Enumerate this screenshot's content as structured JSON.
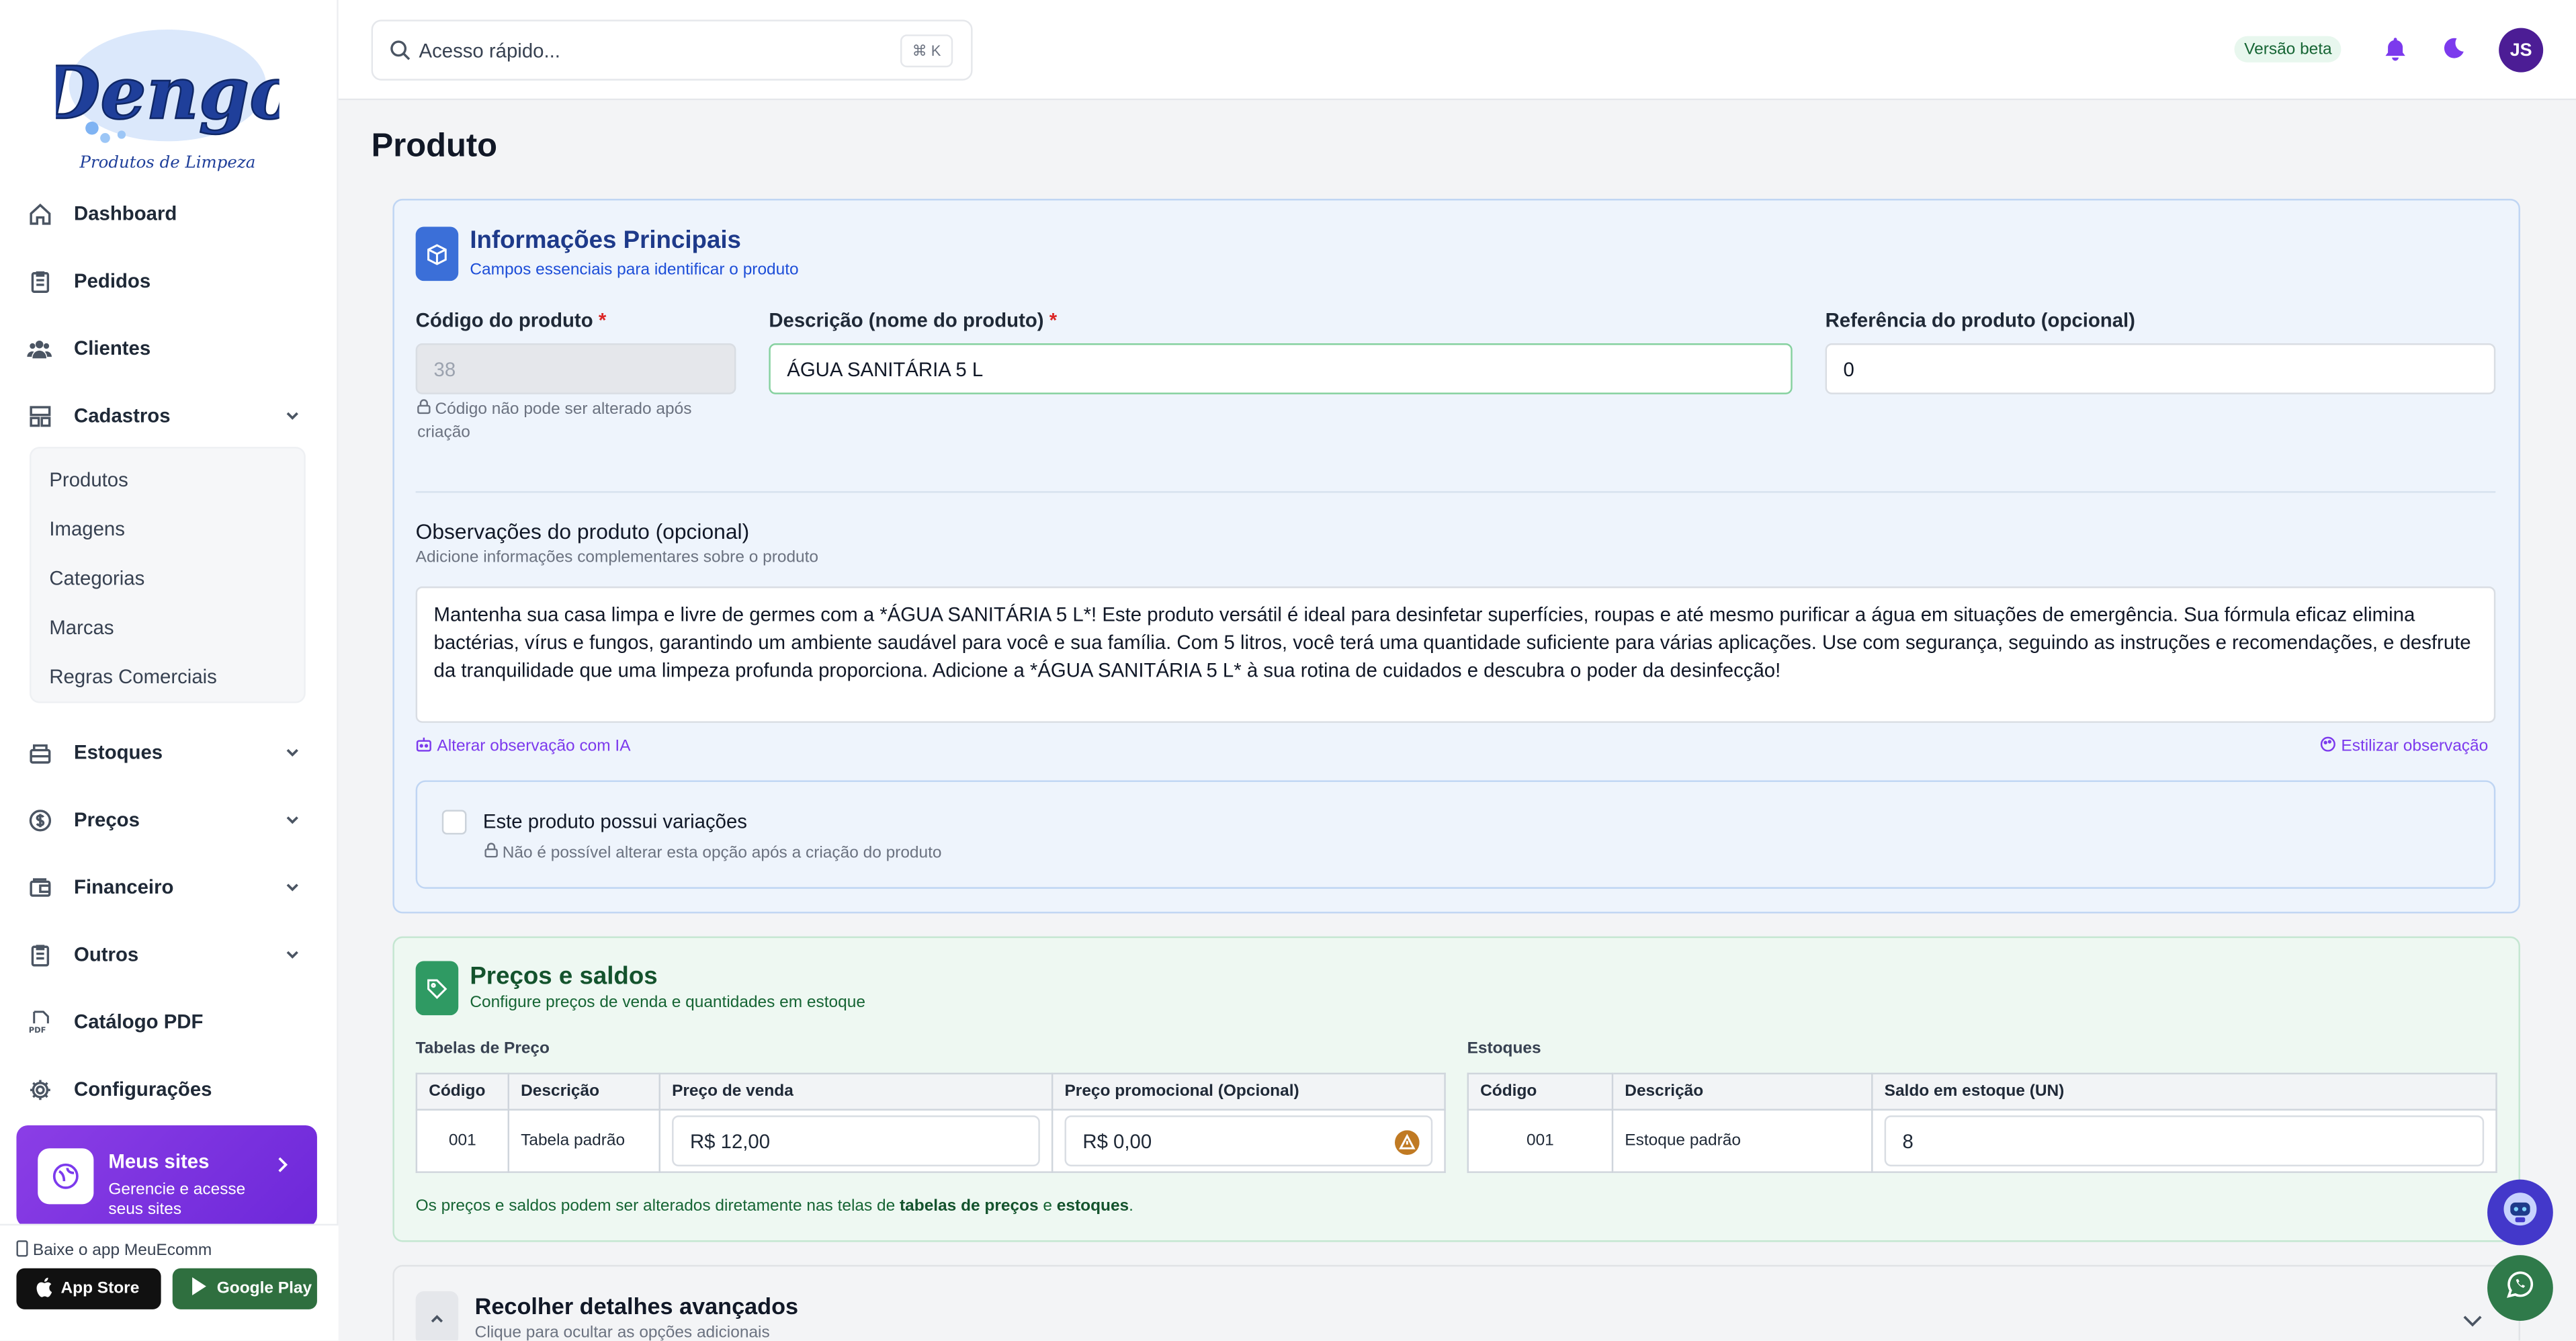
{
  "brand": {
    "logo_text": "Dengo",
    "logo_tagline": "Produtos de Limpeza"
  },
  "sidebar": {
    "items": [
      {
        "label": "Dashboard",
        "icon": "home-icon"
      },
      {
        "label": "Pedidos",
        "icon": "clipboard-icon"
      },
      {
        "label": "Clientes",
        "icon": "users-icon"
      },
      {
        "label": "Cadastros",
        "icon": "grid-icon",
        "expanded": true
      },
      {
        "label": "Estoques",
        "icon": "box-icon"
      },
      {
        "label": "Preços",
        "icon": "dollar-icon"
      },
      {
        "label": "Financeiro",
        "icon": "wallet-icon"
      },
      {
        "label": "Outros",
        "icon": "clipboard-icon"
      },
      {
        "label": "Catálogo PDF",
        "icon": "pdf-icon"
      },
      {
        "label": "Configurações",
        "icon": "gear-icon"
      }
    ],
    "subitems": [
      "Produtos",
      "Imagens",
      "Categorias",
      "Marcas",
      "Regras Comerciais"
    ],
    "promo": {
      "title": "Meus sites",
      "subtitle": "Gerencie e acesse seus sites"
    },
    "app": {
      "label": "Baixe o app MeuEcomm",
      "app_store": "App Store",
      "google_play": "Google Play"
    }
  },
  "topbar": {
    "search_placeholder": "Acesso rápido...",
    "shortcut": "⌘ K",
    "beta": "Versão beta",
    "avatar": "JS"
  },
  "page": {
    "title": "Produto"
  },
  "info": {
    "title": "Informações Principais",
    "subtitle": "Campos essenciais para identificar o produto",
    "code_label": "Código do produto",
    "code_value": "38",
    "code_hint": "Código não pode ser alterado após criação",
    "desc_label": "Descrição (nome do produto)",
    "desc_value": "ÁGUA SANITÁRIA 5 L",
    "ref_label": "Referência do produto (opcional)",
    "ref_value": "0",
    "obs_label": "Observações do produto (opcional)",
    "obs_sub": "Adicione informações complementares sobre o produto",
    "obs_value": "Mantenha sua casa limpa e livre de germes com a *ÁGUA SANITÁRIA 5 L*! Este produto versátil é ideal para desinfetar superfícies, roupas e até mesmo purificar a água em situações de emergência. Sua fórmula eficaz elimina bactérias, vírus e fungos, garantindo um ambiente saudável para você e sua família. Com 5 litros, você terá uma quantidade suficiente para várias aplicações. Use com segurança, seguindo as instruções e recomendações, e desfrute da tranquilidade que uma limpeza profunda proporciona. Adicione a *ÁGUA SANITÁRIA 5 L* à sua rotina de cuidados e descubra o poder da desinfecção!",
    "ai_link": "Alterar observação com IA",
    "style_link": "Estilizar observação",
    "variations_label": "Este produto possui variações",
    "variations_hint": "Não é possível alterar esta opção após a criação do produto"
  },
  "prices": {
    "title": "Preços e saldos",
    "subtitle": "Configure preços de venda e quantidades em estoque",
    "tables_label": "Tabelas de Preço",
    "stocks_label": "Estoques",
    "price_headers": [
      "Código",
      "Descrição",
      "Preço de venda",
      "Preço promocional (Opcional)"
    ],
    "price_row": {
      "code": "001",
      "desc": "Tabela padrão",
      "price": "R$ 12,00",
      "promo": "R$ 0,00"
    },
    "stock_headers": [
      "Código",
      "Descrição",
      "Saldo em estoque (UN)"
    ],
    "stock_row": {
      "code": "001",
      "desc": "Estoque padrão",
      "qty": "8"
    },
    "note_prefix": "Os preços e saldos podem ser alterados diretamente nas telas de ",
    "note_link1": "tabelas de preços",
    "note_mid": " e ",
    "note_link2": "estoques",
    "note_suffix": "."
  },
  "advanced": {
    "title": "Recolher detalhes avançados",
    "subtitle": "Clique para ocultar as opções adicionais"
  },
  "colors": {
    "accent": "#6d28d9",
    "blue": "#3b6fd8",
    "green": "#2f9a63"
  }
}
